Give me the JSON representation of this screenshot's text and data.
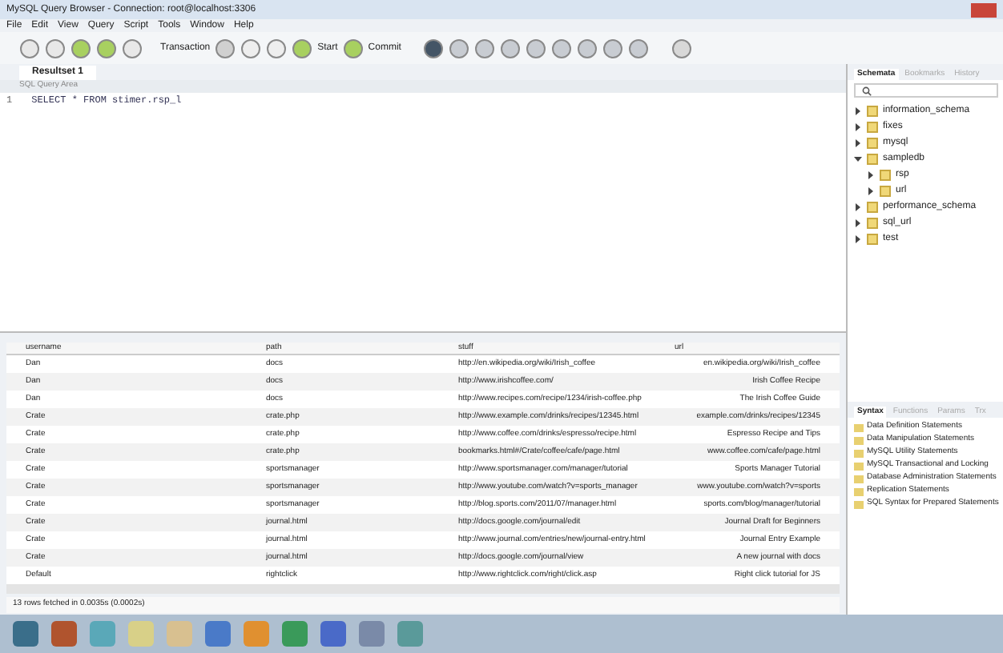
{
  "window": {
    "title": "MySQL Query Browser - Connection: root@localhost:3306"
  },
  "menu": [
    "File",
    "Edit",
    "View",
    "Query",
    "Script",
    "Tools",
    "Window",
    "Help"
  ],
  "toolbar": {
    "labels": [
      "Transaction",
      "Start",
      "Commit"
    ]
  },
  "tabs": [
    {
      "label": "Resultset 1",
      "selected": true
    }
  ],
  "editor": {
    "header": "SQL Query Area",
    "line": "1",
    "query": "SELECT * FROM stimer.rsp_l"
  },
  "table": {
    "columns": [
      "username",
      "path",
      "stuff",
      "url"
    ],
    "rows": [
      [
        "Dan",
        "docs",
        "http://en.wikipedia.org/wiki/Irish_coffee",
        "en.wikipedia.org/wiki/Irish_coffee"
      ],
      [
        "Dan",
        "docs",
        "http://www.irishcoffee.com/",
        "Irish Coffee Recipe"
      ],
      [
        "Dan",
        "docs",
        "http://www.recipes.com/recipe/1234/irish-coffee.php",
        "The Irish Coffee Guide"
      ],
      [
        "Crate",
        "crate.php",
        "http://www.example.com/drinks/recipes/12345.html",
        "example.com/drinks/recipes/12345"
      ],
      [
        "Crate",
        "crate.php",
        "http://www.coffee.com/drinks/espresso/recipe.html",
        "Espresso Recipe and Tips"
      ],
      [
        "Crate",
        "crate.php",
        "bookmarks.html#/Crate/coffee/cafe/page.html",
        "www.coffee.com/cafe/page.html"
      ],
      [
        "Crate",
        "sportsmanager",
        "http://www.sportsmanager.com/manager/tutorial",
        "Sports Manager Tutorial"
      ],
      [
        "Crate",
        "sportsmanager",
        "http://www.youtube.com/watch?v=sports_manager",
        "www.youtube.com/watch?v=sports"
      ],
      [
        "Crate",
        "sportsmanager",
        "http://blog.sports.com/2011/07/manager.html",
        "sports.com/blog/manager/tutorial"
      ],
      [
        "Crate",
        "journal.html",
        "http://docs.google.com/journal/edit",
        "Journal Draft for Beginners"
      ],
      [
        "Crate",
        "journal.html",
        "http://www.journal.com/entries/new/journal-entry.html",
        "Journal Entry Example"
      ],
      [
        "Crate",
        "journal.html",
        "http://docs.google.com/journal/view",
        "A new journal with docs"
      ],
      [
        "Default",
        "rightclick",
        "http://www.rightclick.com/right/click.asp",
        "Right click tutorial for JS"
      ]
    ]
  },
  "status": "13 rows fetched in 0.0035s (0.0002s)",
  "schemata": {
    "tabs": [
      {
        "label": "Schemata",
        "selected": true
      },
      {
        "label": "Bookmarks",
        "selected": false
      },
      {
        "label": "History",
        "selected": false
      }
    ],
    "tree": [
      {
        "label": "information_schema",
        "expanded": false
      },
      {
        "label": "fixes",
        "expanded": false
      },
      {
        "label": "mysql",
        "expanded": false
      },
      {
        "label": "sampledb",
        "expanded": true,
        "children": [
          {
            "label": "rsp",
            "expanded": false
          },
          {
            "label": "url",
            "expanded": false
          }
        ]
      },
      {
        "label": "performance_schema",
        "expanded": false
      },
      {
        "label": "sql_url",
        "expanded": false
      },
      {
        "label": "test",
        "expanded": false
      }
    ]
  },
  "syntax": {
    "tabs": [
      {
        "label": "Syntax",
        "selected": true
      },
      {
        "label": "Functions",
        "selected": false
      },
      {
        "label": "Params",
        "selected": false
      },
      {
        "label": "Trx",
        "selected": false
      }
    ],
    "items": [
      "Data Definition Statements",
      "Data Manipulation Statements",
      "MySQL Utility Statements",
      "MySQL Transactional and Locking",
      "Database Administration Statements",
      "Replication Statements",
      "SQL Syntax for Prepared Statements"
    ]
  }
}
